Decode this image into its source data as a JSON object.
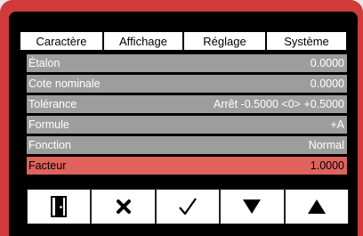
{
  "tabs": [
    "Caractère",
    "Affichage",
    "Réglage",
    "Système"
  ],
  "rows": [
    {
      "label": "Étalon",
      "value": "0.0000"
    },
    {
      "label": "Cote nominale",
      "value": "0.0000"
    },
    {
      "label": "Tolérance",
      "value": "Arrêt -0.5000 <0> +0.5000"
    },
    {
      "label": "Formule",
      "value": "+A"
    },
    {
      "label": "Fonction",
      "value": "Normal"
    },
    {
      "label": "Facteur",
      "value": "1.0000"
    }
  ],
  "buttons": [
    {
      "icon": "door-exit-icon"
    },
    {
      "icon": "close-x-icon"
    },
    {
      "icon": "checkmark-icon"
    },
    {
      "icon": "arrow-down-icon"
    },
    {
      "icon": "arrow-up-icon"
    }
  ],
  "colors": {
    "bezel": "#cf3a3a",
    "row_inactive": "#9d9d9d",
    "row_active": "#e0625d"
  }
}
